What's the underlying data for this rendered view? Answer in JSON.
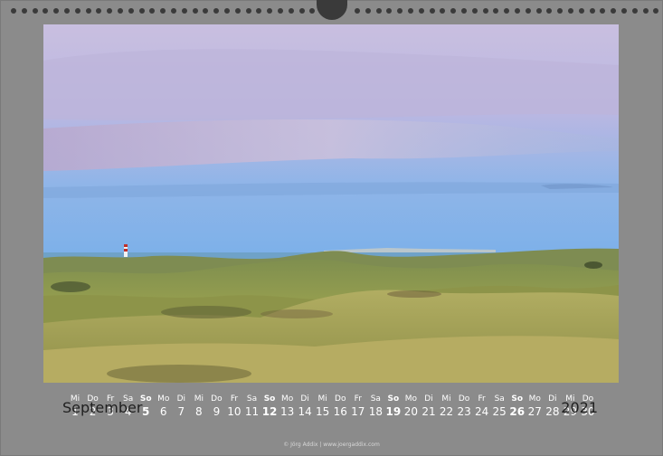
{
  "calendar": {
    "month": "September",
    "year": "2021",
    "credit": "© Jörg Addix | www.joergaddix.com",
    "days": [
      {
        "wd": "Mi",
        "d": "1",
        "sun": false
      },
      {
        "wd": "Do",
        "d": "2",
        "sun": false
      },
      {
        "wd": "Fr",
        "d": "3",
        "sun": false
      },
      {
        "wd": "Sa",
        "d": "4",
        "sun": false
      },
      {
        "wd": "So",
        "d": "5",
        "sun": true
      },
      {
        "wd": "Mo",
        "d": "6",
        "sun": false
      },
      {
        "wd": "Di",
        "d": "7",
        "sun": false
      },
      {
        "wd": "Mi",
        "d": "8",
        "sun": false
      },
      {
        "wd": "Do",
        "d": "9",
        "sun": false
      },
      {
        "wd": "Fr",
        "d": "10",
        "sun": false
      },
      {
        "wd": "Sa",
        "d": "11",
        "sun": false
      },
      {
        "wd": "So",
        "d": "12",
        "sun": true
      },
      {
        "wd": "Mo",
        "d": "13",
        "sun": false
      },
      {
        "wd": "Di",
        "d": "14",
        "sun": false
      },
      {
        "wd": "Mi",
        "d": "15",
        "sun": false
      },
      {
        "wd": "Do",
        "d": "16",
        "sun": false
      },
      {
        "wd": "Fr",
        "d": "17",
        "sun": false
      },
      {
        "wd": "Sa",
        "d": "18",
        "sun": false
      },
      {
        "wd": "So",
        "d": "19",
        "sun": true
      },
      {
        "wd": "Mo",
        "d": "20",
        "sun": false
      },
      {
        "wd": "Di",
        "d": "21",
        "sun": false
      },
      {
        "wd": "Mi",
        "d": "22",
        "sun": false
      },
      {
        "wd": "Do",
        "d": "23",
        "sun": false
      },
      {
        "wd": "Fr",
        "d": "24",
        "sun": false
      },
      {
        "wd": "Sa",
        "d": "25",
        "sun": false
      },
      {
        "wd": "So",
        "d": "26",
        "sun": true
      },
      {
        "wd": "Mo",
        "d": "27",
        "sun": false
      },
      {
        "wd": "Di",
        "d": "28",
        "sun": false
      },
      {
        "wd": "Mi",
        "d": "29",
        "sun": false
      },
      {
        "wd": "Do",
        "d": "30",
        "sun": false
      }
    ]
  },
  "colors": {
    "page_bg": "#8b8b8b",
    "holes": "#3a3a3a",
    "day_text": "#ffffff",
    "title_text": "#1f1f1f"
  },
  "photo": {
    "subject": "dune-landscape-with-lighthouse"
  }
}
